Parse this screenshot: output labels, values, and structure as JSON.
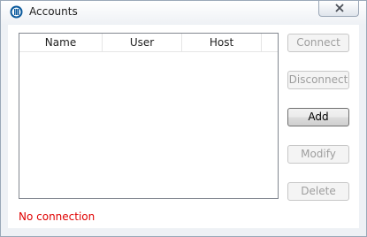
{
  "window": {
    "title": "Accounts",
    "icon": "app-icon"
  },
  "table": {
    "columns": [
      "Name",
      "User",
      "Host",
      ""
    ],
    "rows": []
  },
  "buttons": {
    "connect": "Connect",
    "disconnect": "Disconnect",
    "add": "Add",
    "modify": "Modify",
    "delete": "Delete"
  },
  "status": {
    "text": "No connection",
    "color": "#e00000"
  },
  "colors": {
    "accent": "#0b5a9c"
  }
}
